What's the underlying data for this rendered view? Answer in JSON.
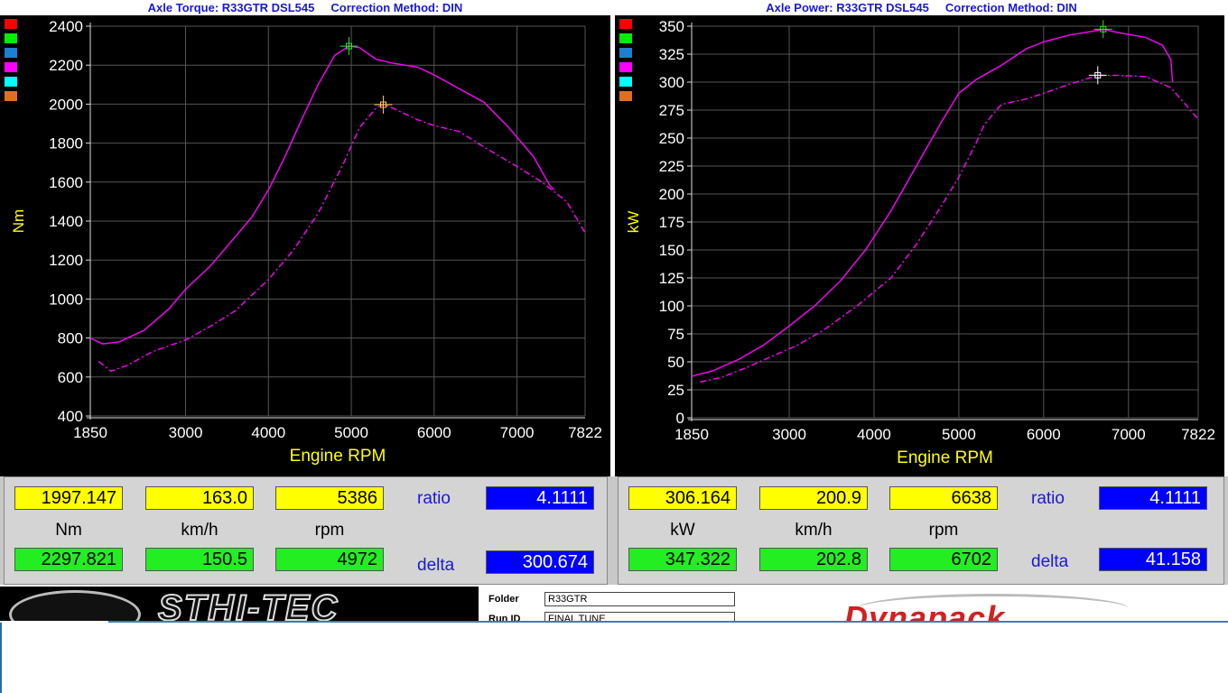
{
  "left_panel": {
    "title": "Axle Torque: R33GTR DSL545     Correction Method: DIN",
    "readout": {
      "row1": [
        "1997.147",
        "163.0",
        "5386"
      ],
      "units": [
        "Nm",
        "km/h",
        "rpm"
      ],
      "row2": [
        "2297.821",
        "150.5",
        "4972"
      ],
      "ratio_label": "ratio",
      "ratio_value": "4.1111",
      "delta_label": "delta",
      "delta_value": "300.674"
    }
  },
  "right_panel": {
    "title": "Axle Power: R33GTR DSL545     Correction Method: DIN",
    "readout": {
      "row1": [
        "306.164",
        "200.9",
        "6638"
      ],
      "units": [
        "kW",
        "km/h",
        "rpm"
      ],
      "row2": [
        "347.322",
        "202.8",
        "6702"
      ],
      "ratio_label": "ratio",
      "ratio_value": "4.1111",
      "delta_label": "delta",
      "delta_value": "41.158"
    }
  },
  "legend_colors": [
    "#ff0000",
    "#00ee00",
    "#1e7fd0",
    "#ff00ff",
    "#00ffff",
    "#e07020"
  ],
  "chart_data": [
    {
      "type": "line",
      "title": "Axle Torque: R33GTR DSL545     Correction Method: DIN",
      "xlabel": "Engine RPM",
      "ylabel": "Nm",
      "xlim": [
        1850,
        7822
      ],
      "ylim": [
        400,
        2400
      ],
      "xticks": [
        1850,
        3000,
        4000,
        5000,
        6000,
        7000,
        7822
      ],
      "yticks": [
        400,
        600,
        800,
        1000,
        1200,
        1400,
        1600,
        1800,
        2000,
        2200,
        2400
      ],
      "grid": true,
      "series": [
        {
          "style": "solid",
          "color": "#ff00ff",
          "x": [
            1850,
            2000,
            2200,
            2500,
            2800,
            3000,
            3300,
            3600,
            3800,
            4000,
            4200,
            4400,
            4600,
            4800,
            4972,
            5100,
            5300,
            5500,
            5800,
            6000,
            6300,
            6600,
            6900,
            7200,
            7400,
            7450
          ],
          "y": [
            800,
            770,
            780,
            840,
            950,
            1050,
            1170,
            1320,
            1420,
            1560,
            1730,
            1920,
            2100,
            2250,
            2298,
            2290,
            2230,
            2210,
            2190,
            2150,
            2080,
            2010,
            1880,
            1730,
            1580,
            1560
          ]
        },
        {
          "style": "dashdot",
          "color": "#ff00ff",
          "x": [
            1950,
            2100,
            2300,
            2600,
            3000,
            3300,
            3600,
            4000,
            4300,
            4600,
            4900,
            5100,
            5300,
            5386,
            5500,
            5800,
            6000,
            6300,
            6600,
            7000,
            7300,
            7600,
            7822
          ],
          "y": [
            680,
            630,
            660,
            730,
            790,
            860,
            940,
            1100,
            1250,
            1440,
            1690,
            1880,
            1980,
            1997,
            1980,
            1920,
            1890,
            1860,
            1780,
            1680,
            1600,
            1500,
            1340
          ]
        }
      ]
    },
    {
      "type": "line",
      "title": "Axle Power: R33GTR DSL545     Correction Method: DIN",
      "xlabel": "Engine RPM",
      "ylabel": "kW",
      "xlim": [
        1850,
        7822
      ],
      "ylim": [
        0,
        350
      ],
      "xticks": [
        1850,
        3000,
        4000,
        5000,
        6000,
        7000,
        7822
      ],
      "yticks": [
        0,
        25,
        50,
        75,
        100,
        125,
        150,
        175,
        200,
        225,
        250,
        275,
        300,
        325,
        350
      ],
      "grid": true,
      "series": [
        {
          "style": "solid",
          "color": "#ff00ff",
          "x": [
            1850,
            2100,
            2400,
            2700,
            3000,
            3300,
            3600,
            3900,
            4200,
            4500,
            4800,
            5000,
            5200,
            5500,
            5800,
            6000,
            6300,
            6702,
            6900,
            7200,
            7400,
            7500,
            7520
          ],
          "y": [
            37,
            42,
            52,
            65,
            82,
            100,
            122,
            150,
            185,
            225,
            265,
            290,
            302,
            315,
            330,
            336,
            342,
            347,
            344,
            340,
            333,
            320,
            300
          ]
        },
        {
          "style": "dashdot",
          "color": "#ff00ff",
          "x": [
            1950,
            2200,
            2500,
            2800,
            3100,
            3400,
            3800,
            4200,
            4500,
            4800,
            5000,
            5200,
            5300,
            5500,
            5800,
            6000,
            6300,
            6638,
            6900,
            7200,
            7500,
            7822
          ],
          "y": [
            32,
            36,
            45,
            55,
            65,
            78,
            100,
            125,
            155,
            190,
            215,
            245,
            262,
            280,
            285,
            290,
            298,
            306,
            306,
            305,
            295,
            267
          ]
        }
      ]
    }
  ],
  "footer": {
    "brand_left": "STHI-TEC",
    "folder_label": "Folder",
    "folder_value": "R33GTR",
    "runid_label": "Run ID",
    "runid_value": "FINAL TUNE",
    "brand_right": "Dynapack"
  }
}
